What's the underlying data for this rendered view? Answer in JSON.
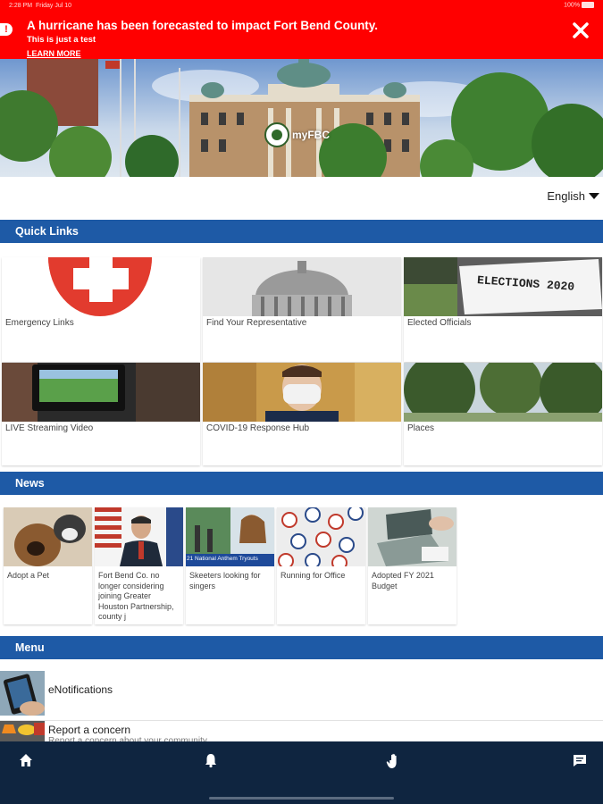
{
  "status_bar": {
    "time": "2:28 PM",
    "date": "Friday Jul 10",
    "battery": "100%"
  },
  "alert": {
    "title": "A hurricane has been forecasted to impact Fort Bend County.",
    "subtitle": "This is just a test",
    "link": "LEARN MORE"
  },
  "hero": {
    "logo_text": "myFBC"
  },
  "language": {
    "selected": "English"
  },
  "sections": {
    "quick_links": "Quick Links",
    "news": "News",
    "menu": "Menu"
  },
  "quick_links": [
    {
      "label": "Emergency Links"
    },
    {
      "label": "Find Your Representative"
    },
    {
      "label": "Elected Officials",
      "image_text": "ELECTIONS 2020"
    },
    {
      "label": "LIVE Streaming Video"
    },
    {
      "label": "COVID-19 Response Hub"
    },
    {
      "label": "Places"
    }
  ],
  "news": [
    {
      "label": "Adopt a Pet"
    },
    {
      "label": "Fort Bend Co. no longer considering joining Greater Houston Partnership, county j"
    },
    {
      "label": "Skeeters looking for singers",
      "image_text": "21 National Anthem Tryouts"
    },
    {
      "label": "Running for Office"
    },
    {
      "label": "Adopted FY 2021 Budget"
    }
  ],
  "menu": [
    {
      "title": "eNotifications",
      "subtitle": ""
    },
    {
      "title": "Report a concern",
      "subtitle": "Report a concern about your community"
    }
  ],
  "colors": {
    "alert": "#ff0000",
    "section": "#1e5aa6",
    "nav": "#0f2540"
  }
}
